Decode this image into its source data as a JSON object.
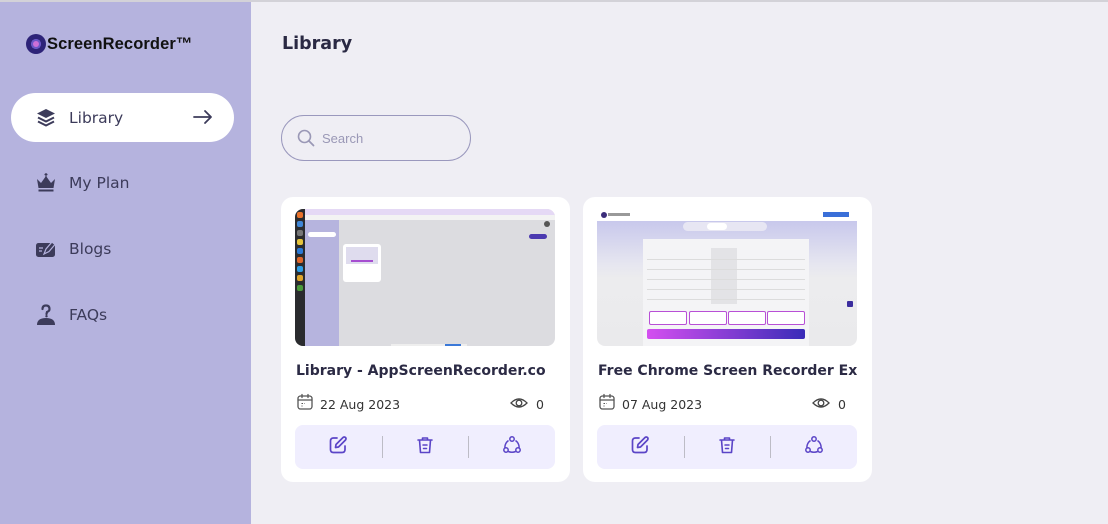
{
  "app": {
    "name": "ScreenRecorder™"
  },
  "sidebar": {
    "items": [
      {
        "label": "Library",
        "icon": "layers-icon",
        "active": true
      },
      {
        "label": "My Plan",
        "icon": "crown-icon",
        "active": false
      },
      {
        "label": "Blogs",
        "icon": "blog-edit-icon",
        "active": false
      },
      {
        "label": "FAQs",
        "icon": "faq-person-icon",
        "active": false
      }
    ]
  },
  "main": {
    "title": "Library",
    "search": {
      "placeholder": "Search",
      "value": ""
    },
    "recordings": [
      {
        "title": "Library - AppScreenRecorder.co",
        "date": "22 Aug 2023",
        "views": "0"
      },
      {
        "title": "Free Chrome Screen Recorder Ex",
        "date": "07 Aug 2023",
        "views": "0"
      }
    ],
    "actions": {
      "edit": "edit-icon",
      "delete": "trash-icon",
      "share": "share-icon"
    }
  },
  "colors": {
    "sidebar_bg": "#b5b3de",
    "main_bg": "#efeef4",
    "accent": "#5b45c7",
    "action_bar_bg": "#f0eefe"
  }
}
